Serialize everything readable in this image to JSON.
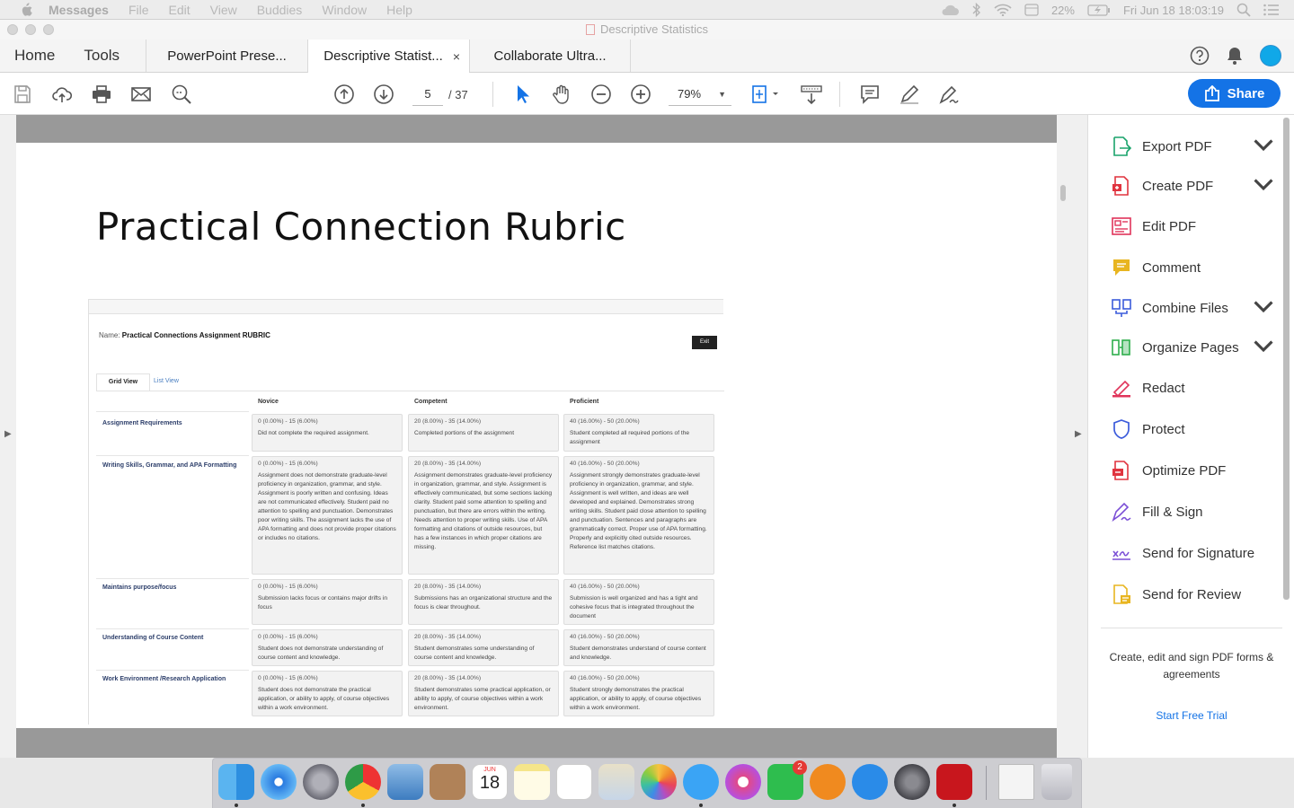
{
  "menubar": {
    "app": "Messages",
    "items": [
      "File",
      "Edit",
      "View",
      "Buddies",
      "Window",
      "Help"
    ],
    "battery": "22%",
    "datetime": "Fri Jun 18  18:03:19"
  },
  "window": {
    "title": "Descriptive Statistics"
  },
  "tabs": {
    "home": "Home",
    "tools": "Tools",
    "documents": [
      "PowerPoint Prese...",
      "Descriptive Statist...",
      "Collaborate Ultra..."
    ],
    "close_glyph": "×"
  },
  "toolbar": {
    "page_current": "5",
    "page_total": "/ 37",
    "zoom": "79%",
    "share_label": "Share"
  },
  "document": {
    "slide_title": "Practical Connection Rubric",
    "rubric": {
      "name_label": "Name:",
      "name_value": "Practical Connections Assignment RUBRIC",
      "exit_label": "Exit",
      "grid_tab": "Grid View",
      "list_tab": "List View",
      "columns": [
        "Novice",
        "Competent",
        "Proficient"
      ],
      "rows": [
        {
          "label": "Assignment Requirements",
          "cells": [
            {
              "points": "0 (0.00%) - 15 (6.00%)",
              "text": "Did not complete the required assignment."
            },
            {
              "points": "20 (8.00%) - 35 (14.00%)",
              "text": "Completed portions of the assignment"
            },
            {
              "points": "40 (16.00%) - 50 (20.00%)",
              "text": "Student completed all required portions of the assignment"
            }
          ]
        },
        {
          "label": "Writing Skills, Grammar, and APA Formatting",
          "cells": [
            {
              "points": "0 (0.00%) - 15 (6.00%)",
              "text": "Assignment does not demonstrate graduate-level proficiency in organization, grammar, and style. Assignment is poorly written and confusing. Ideas are not communicated effectively. Student paid no attention to spelling and punctuation. Demonstrates poor writing skills. The assignment lacks the use of APA formatting and does not provide proper citations or includes no citations."
            },
            {
              "points": "20 (8.00%) - 35 (14.00%)",
              "text": "Assignment demonstrates graduate-level proficiency in organization, grammar, and style. Assignment is effectively communicated, but some sections lacking clarity. Student paid some attention to spelling and punctuation, but there are errors within the writing. Needs attention to proper writing skills. Use of APA formatting and citations of outside resources, but has a few instances in which proper citations are missing."
            },
            {
              "points": "40 (16.00%) - 50 (20.00%)",
              "text": "Assignment strongly demonstrates graduate-level proficiency in organization, grammar, and style. Assignment is well written, and ideas are well developed and explained. Demonstrates strong writing skills. Student paid close attention to spelling and punctuation. Sentences and paragraphs are grammatically correct. Proper use of APA formatting. Properly and explicitly cited outside resources. Reference list matches citations."
            }
          ]
        },
        {
          "label": "Maintains purpose/focus",
          "cells": [
            {
              "points": "0 (0.00%) - 15 (6.00%)",
              "text": "Submission lacks focus or contains major drifts in focus"
            },
            {
              "points": "20 (8.00%) - 35 (14.00%)",
              "text": "Submissions has an organizational structure and the focus is clear throughout."
            },
            {
              "points": "40 (16.00%) - 50 (20.00%)",
              "text": "Submission is well organized and has a tight and cohesive focus that is integrated throughout the document"
            }
          ]
        },
        {
          "label": "Understanding of Course Content",
          "cells": [
            {
              "points": "0 (0.00%) - 15 (6.00%)",
              "text": "Student does not demonstrate understanding of course content and knowledge."
            },
            {
              "points": "20 (8.00%) - 35 (14.00%)",
              "text": "Student demonstrates some understanding of course content and knowledge."
            },
            {
              "points": "40 (16.00%) - 50 (20.00%)",
              "text": "Student demonstrates understand of course content and knowledge."
            }
          ]
        },
        {
          "label": "Work Environment /Research Application",
          "cells": [
            {
              "points": "0 (0.00%) - 15 (6.00%)",
              "text": "Student does not demonstrate the practical application, or ability to apply, of course objectives within a work environment."
            },
            {
              "points": "20 (8.00%) - 35 (14.00%)",
              "text": "Student demonstrates some practical application, or ability to apply, of course objectives within a work environment."
            },
            {
              "points": "40 (16.00%) - 50 (20.00%)",
              "text": "Student strongly demonstrates the practical application, or ability to apply, of course objectives within a work environment."
            }
          ]
        }
      ]
    }
  },
  "right_panel": {
    "tools": [
      {
        "label": "Export PDF",
        "icon": "export-pdf-icon",
        "color": "#1aa36b",
        "expand": true
      },
      {
        "label": "Create PDF",
        "icon": "create-pdf-icon",
        "color": "#e0343f",
        "expand": true
      },
      {
        "label": "Edit PDF",
        "icon": "edit-pdf-icon",
        "color": "#e0345a",
        "expand": false
      },
      {
        "label": "Comment",
        "icon": "comment-icon",
        "color": "#e8b520",
        "expand": false
      },
      {
        "label": "Combine Files",
        "icon": "combine-files-icon",
        "color": "#3b5bdb",
        "expand": true
      },
      {
        "label": "Organize Pages",
        "icon": "organize-pages-icon",
        "color": "#2fae4c",
        "expand": true
      },
      {
        "label": "Redact",
        "icon": "redact-icon",
        "color": "#e0345a",
        "expand": false
      },
      {
        "label": "Protect",
        "icon": "protect-icon",
        "color": "#3b5bdb",
        "expand": false
      },
      {
        "label": "Optimize PDF",
        "icon": "optimize-pdf-icon",
        "color": "#e0343f",
        "expand": false
      },
      {
        "label": "Fill & Sign",
        "icon": "fill-sign-icon",
        "color": "#7b4fd6",
        "expand": false
      },
      {
        "label": "Send for Signature",
        "icon": "send-signature-icon",
        "color": "#7b4fd6",
        "expand": false
      },
      {
        "label": "Send for Review",
        "icon": "send-review-icon",
        "color": "#e8b520",
        "expand": false
      }
    ],
    "promo": "Create, edit and sign PDF forms & agreements",
    "trial_link": "Start Free Trial"
  },
  "dock": {
    "apps": [
      "finder",
      "safari",
      "launchpad",
      "chrome",
      "mail",
      "contacts",
      "calendar",
      "notes",
      "reminders",
      "preview",
      "photos",
      "messages",
      "itunes",
      "facetime",
      "ibooks",
      "app-store",
      "system-preferences",
      "acrobat",
      "downloads",
      "trash"
    ],
    "calendar_month": "JUN",
    "calendar_day": "18",
    "facetime_badge": "2"
  }
}
